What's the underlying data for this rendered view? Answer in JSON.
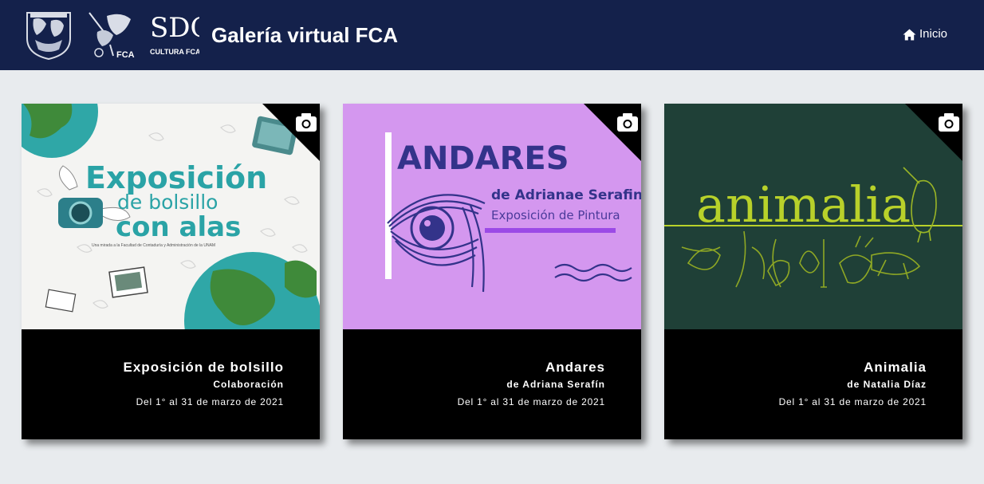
{
  "header": {
    "title": "Galería virtual FCA",
    "nav_home": "Inicio",
    "background": "#14214b"
  },
  "logos": {
    "cultura_mark": "SDC",
    "cultura_label": "CULTURA FCA",
    "fca_label": "FCA"
  },
  "cards": [
    {
      "title": "Exposición de bolsillo",
      "subtitle": "Colaboración",
      "dates": "Del 1° al 31 de marzo de 2021",
      "poster": {
        "line1": "Exposición",
        "line2": "de bolsillo",
        "line3": "con alas",
        "tagline": "Una mirada a la Facultad de Contaduría y Administración de la UNAM"
      },
      "icon": "camera-icon"
    },
    {
      "title": "Andares",
      "subtitle": "de Adriana Serafín",
      "dates": "Del 1° al 31 de marzo de 2021",
      "poster": {
        "heading": "ANDARES",
        "author": "de Adrianae Serafin",
        "caption": "Exposición de Pintura"
      },
      "icon": "camera-icon"
    },
    {
      "title": "Animalia",
      "subtitle": "de Natalia Díaz",
      "dates": "Del 1° al 31 de marzo de 2021",
      "poster": {
        "heading": "animalia"
      },
      "icon": "camera-icon"
    }
  ],
  "colors": {
    "page_bg": "#e8ebee",
    "card_info_bg": "#000000",
    "andares_bg": "#d497ef",
    "animalia_bg": "#1f4037",
    "animalia_accent": "#b8d12a",
    "bolsillo_text": "#2aa3a6"
  }
}
